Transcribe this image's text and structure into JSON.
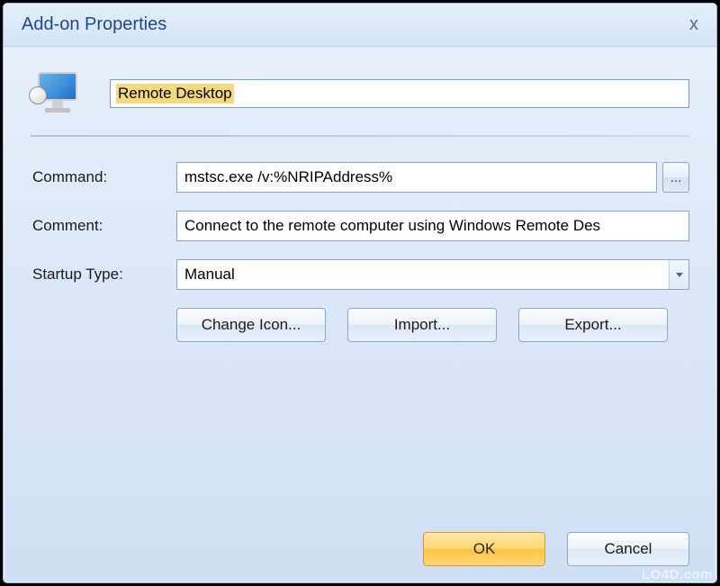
{
  "window": {
    "title": "Add-on Properties",
    "close_label": "x"
  },
  "form": {
    "name_value": "Remote Desktop",
    "labels": {
      "command": "Command:",
      "comment": "Comment:",
      "startup_type": "Startup Type:"
    },
    "command_value": "mstsc.exe /v:%NRIPAddress%",
    "browse_label": "...",
    "comment_value": "Connect to the remote computer using Windows Remote Des",
    "startup_type_value": "Manual",
    "buttons": {
      "change_icon": "Change Icon...",
      "import": "Import...",
      "export": "Export..."
    }
  },
  "footer": {
    "ok": "OK",
    "cancel": "Cancel"
  },
  "watermark": "LO4D.com",
  "icons": {
    "app": "remote-desktop-monitor-icon"
  }
}
